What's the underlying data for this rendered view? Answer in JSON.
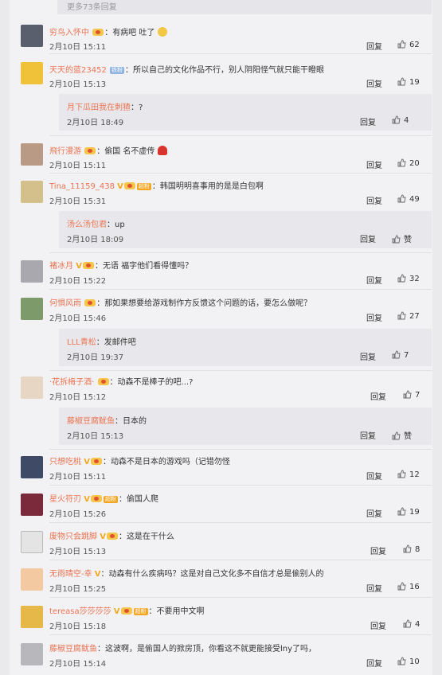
{
  "more_replies": "更多73条回复",
  "reply_label": "回复",
  "like_label": "赞",
  "badges": {
    "iron_fan": "铁粉",
    "super_fan": "超粉"
  },
  "vip_mark": "V",
  "comments": [
    {
      "user": "穷鸟入怀中",
      "text": "有病吧 吐了",
      "date": "2月10日 15:11",
      "likes": "62"
    },
    {
      "user": "天天的蓝23452",
      "text": "所以自己的文化作品不行，别人阴阳怪气就只能干瞪眼",
      "date": "2月10日 15:13",
      "likes": "19",
      "subreply": {
        "user": "月下瓜田我在刺猹",
        "text": "?",
        "date": "2月10日 18:49",
        "likes": "4"
      }
    },
    {
      "user": "飛行漫游",
      "text": "偷国 名不虚传",
      "date": "2月10日 15:11",
      "likes": "20"
    },
    {
      "user": "Tina_11159_438",
      "text": "韩国明明喜事用的是是白包啊",
      "date": "2月10日 15:31",
      "likes": "49",
      "subreply": {
        "user": "汤么汤包君",
        "text": "up",
        "date": "2月10日 18:09",
        "likes": "赞"
      }
    },
    {
      "user": "褚冰月",
      "text": "无语 福字他们看得懂吗？",
      "date": "2月10日 15:22",
      "likes": "32"
    },
    {
      "user": "何惧风雨",
      "text": "那如果想要给游戏制作方反馈这个问题的话，要怎么做呢？",
      "date": "2月10日 15:46",
      "likes": "27",
      "subreply": {
        "user": "LLL青松",
        "text": "发邮件吧",
        "date": "2月10日 19:37",
        "likes": "7"
      }
    },
    {
      "user": "·花拆梅子酒·",
      "text": "动森不是棒子的吧...?",
      "date": "2月10日 15:12",
      "likes": "7",
      "subreply": {
        "user": "藤椒豆腐鱿鱼",
        "text": "日本的",
        "date": "2月10日 15:13",
        "likes": "赞"
      }
    },
    {
      "user": "只想吃桃",
      "text": "动森不是日本的游戏吗（记错勿怪",
      "date": "2月10日 15:11",
      "likes": "12"
    },
    {
      "user": "星火符刃",
      "text": "偷国人爬",
      "date": "2月10日 15:26",
      "likes": "19"
    },
    {
      "user": "废物只会跳脚",
      "text": "这是在干什么",
      "date": "2月10日 15:13",
      "likes": "8"
    },
    {
      "user": "无雨晴空-幸",
      "text": "动森有什么疾病吗？这是对自己文化多不自信才总是偷别人的",
      "date": "2月10日 15:25",
      "likes": "16"
    },
    {
      "user": "tereasa莎莎莎莎",
      "text": "不要用中文啊",
      "date": "2月10日 15:18",
      "likes": "4"
    },
    {
      "user": "藤椒豆腐鱿鱼",
      "text": "这波啊，是偷国人的掀房顶，你看这不就更能接受lny了吗，",
      "date": "2月10日 15:14",
      "likes": "10"
    }
  ],
  "colors": {
    "username": "#eb7350",
    "panel": "#f2f2f5",
    "subreply_bg": "#e8e8ec",
    "vip": "#f2a91d"
  }
}
